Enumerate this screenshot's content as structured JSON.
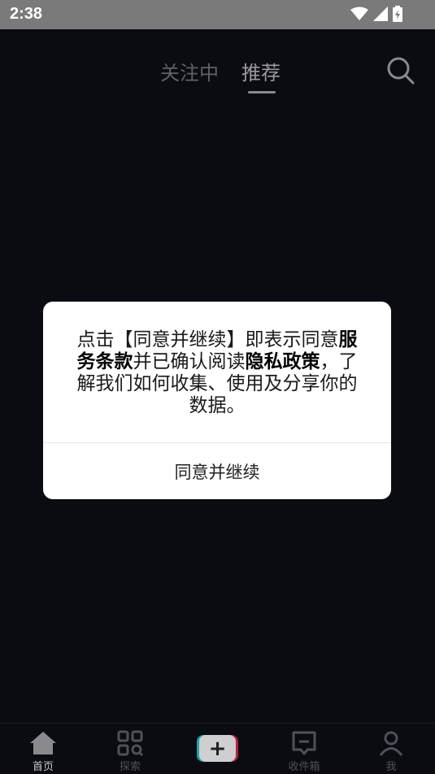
{
  "status_bar": {
    "time": "2:38",
    "icons": [
      "wifi-icon",
      "cell-signal-icon",
      "battery-charging-icon"
    ]
  },
  "top_nav": {
    "tabs": [
      {
        "label": "关注中",
        "active": false
      },
      {
        "label": "推荐",
        "active": true
      }
    ],
    "search_icon": "search-icon"
  },
  "dialog": {
    "message_parts": [
      {
        "text": "点击【同意并继续】即表示同意",
        "bold": false
      },
      {
        "text": "服务条款",
        "bold": true
      },
      {
        "text": "并已确认阅读",
        "bold": false
      },
      {
        "text": "隐私政策",
        "bold": true
      },
      {
        "text": "，了解我们如何收集、使用及分享你的数据。",
        "bold": false
      }
    ],
    "agree_label": "同意并继续"
  },
  "bottom_nav": {
    "items": [
      {
        "label": "首页",
        "icon": "home-icon",
        "active": true
      },
      {
        "label": "探索",
        "icon": "discover-grid-icon",
        "active": false
      },
      {
        "label": "",
        "icon": "plus-icon",
        "active": false
      },
      {
        "label": "收件箱",
        "icon": "inbox-icon",
        "active": false
      },
      {
        "label": "我",
        "icon": "profile-icon",
        "active": false
      }
    ],
    "create_symbol": "+"
  },
  "colors": {
    "background": "#0b0c12",
    "status_bar": "#7a7a7a",
    "accent_cyan": "#1aa6a8",
    "accent_red": "#b02040"
  }
}
